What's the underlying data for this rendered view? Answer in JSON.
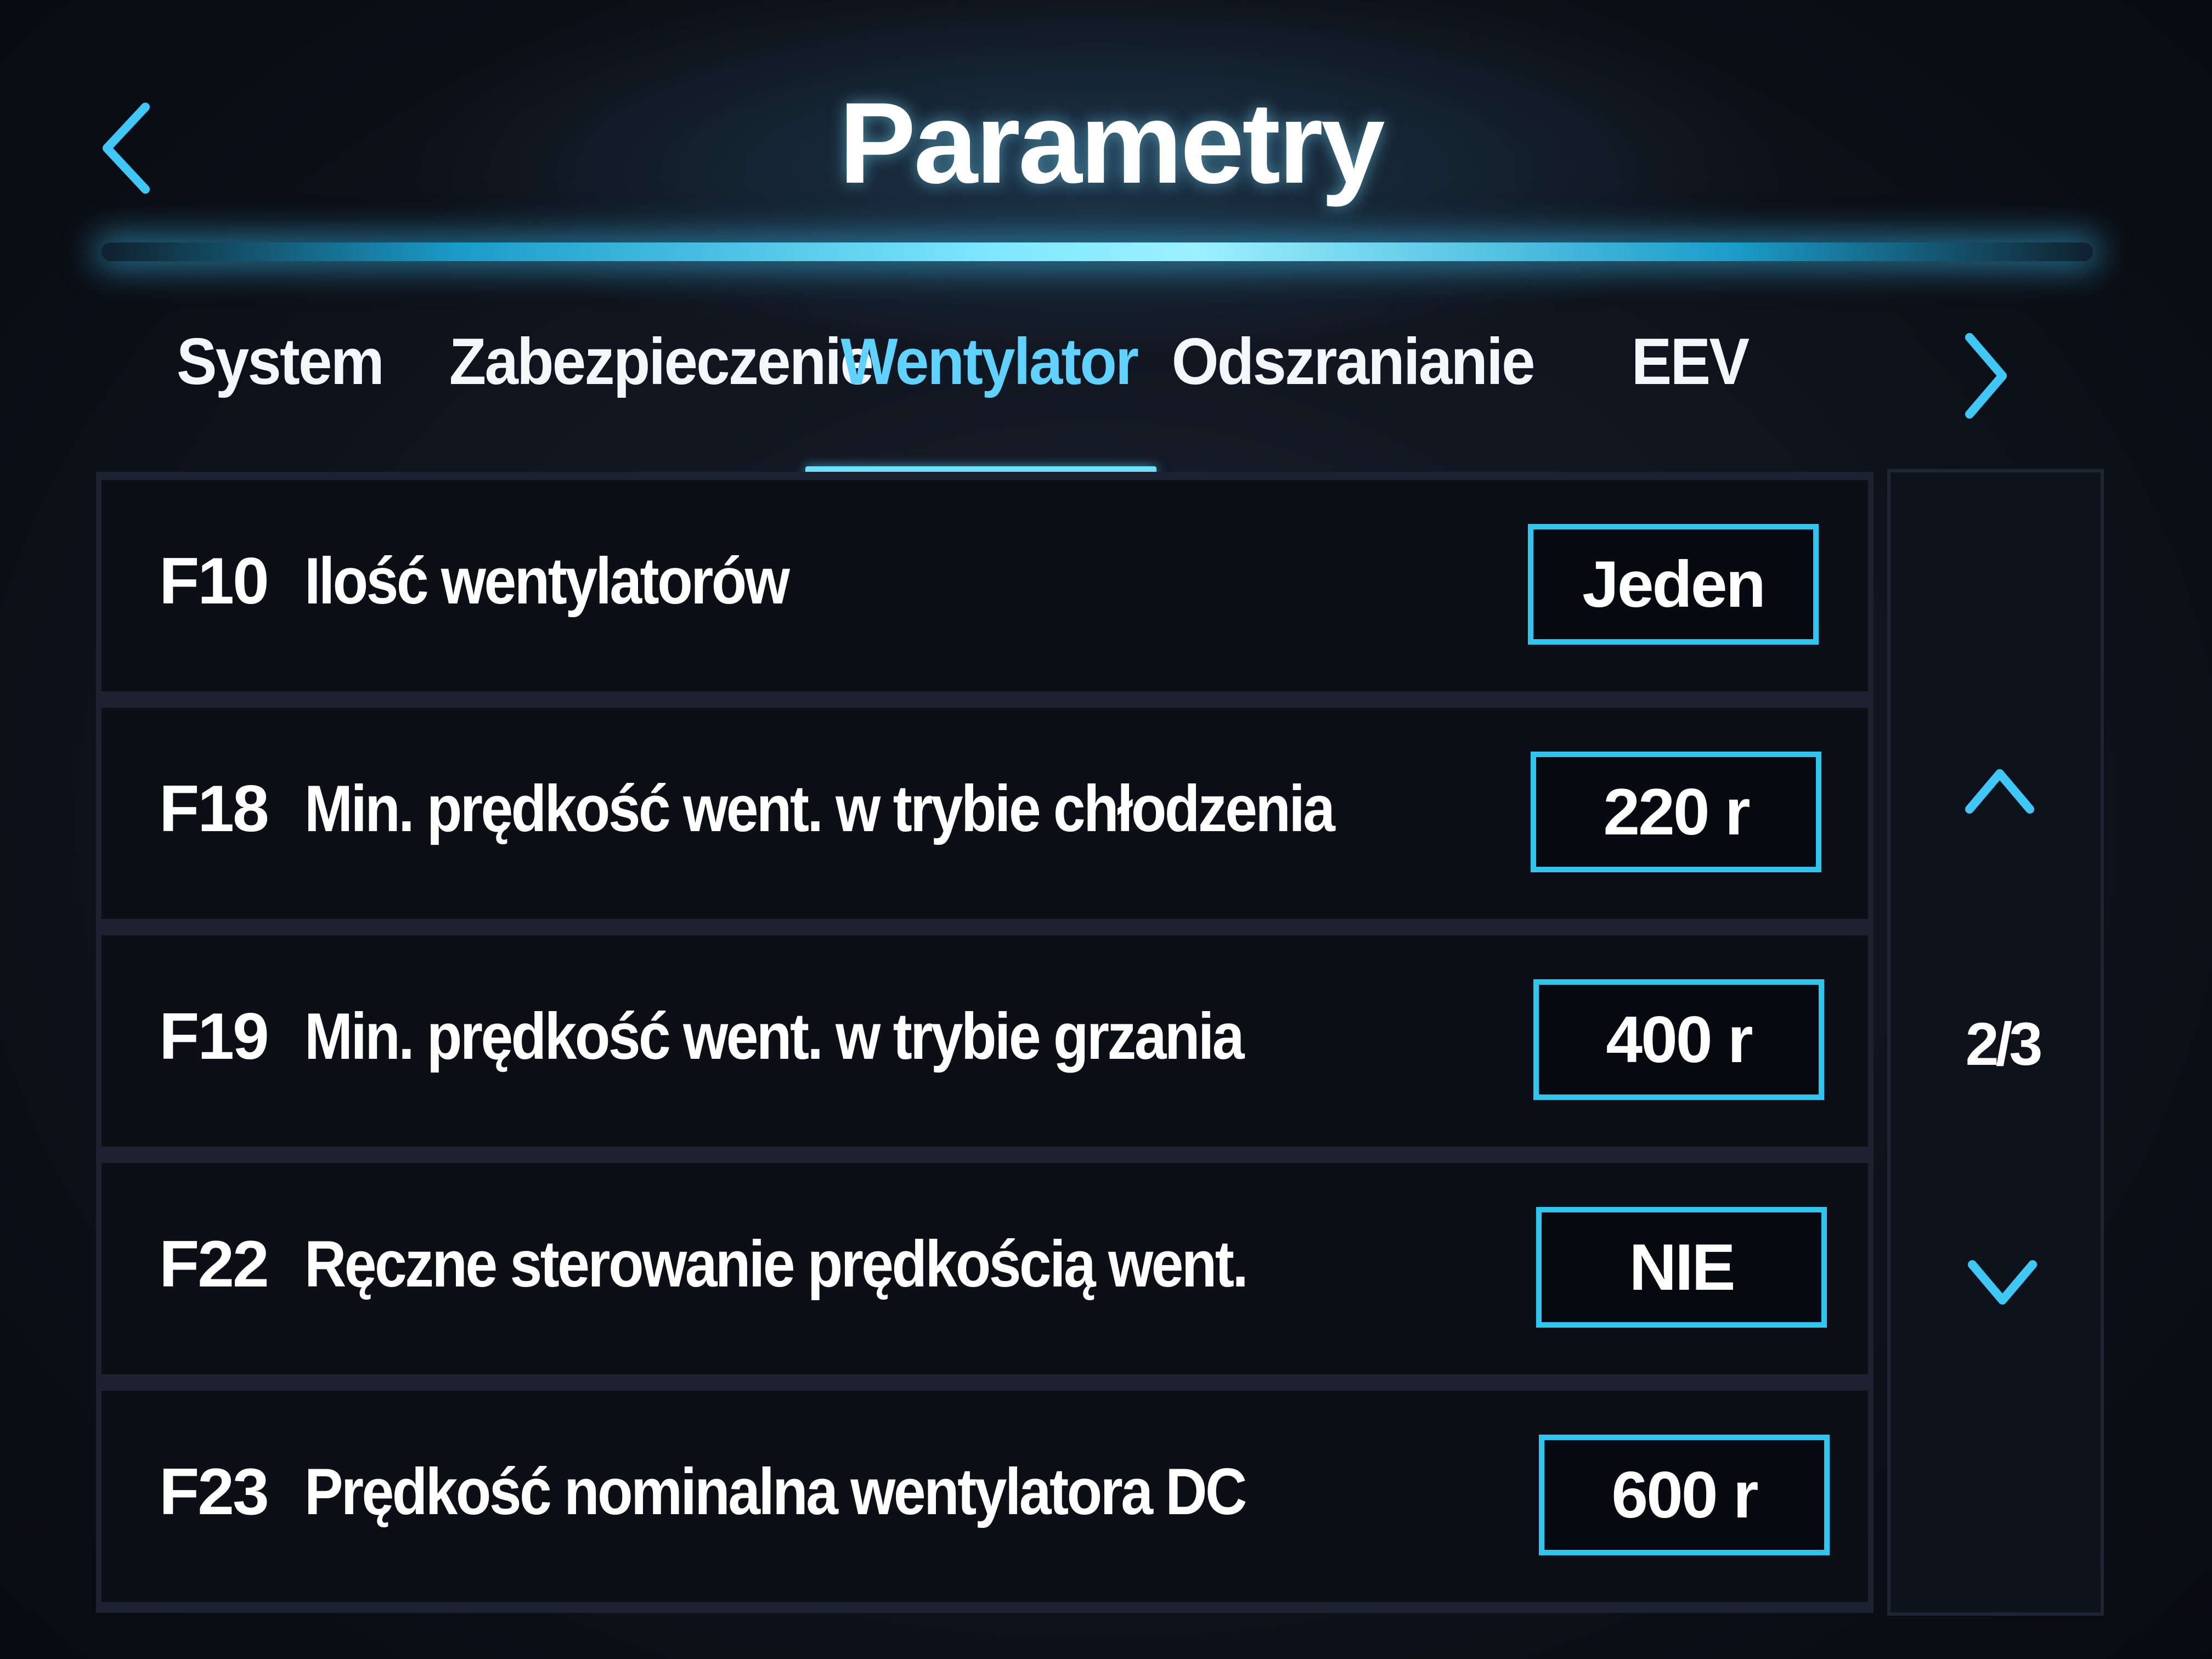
{
  "header": {
    "title": "Parametry",
    "back_icon": "chevron-left-icon"
  },
  "tabs": [
    {
      "label": "System",
      "active": false
    },
    {
      "label": "Zabezpieczenie",
      "active": false
    },
    {
      "label": "Wentylator",
      "active": true
    },
    {
      "label": "Odszranianie",
      "active": false
    },
    {
      "label": "EEV",
      "active": false
    }
  ],
  "tabs_next_icon": "chevron-right-icon",
  "parameters": [
    {
      "code": "F10",
      "label": "Ilość wentylatorów",
      "value": "Jeden"
    },
    {
      "code": "F18",
      "label": "Min. prędkość went. w trybie chłodzenia",
      "value": "220 r"
    },
    {
      "code": "F19",
      "label": "Min. prędkość went. w trybie grzania",
      "value": "400 r"
    },
    {
      "code": "F22",
      "label": "Ręczne sterowanie prędkością went.",
      "value": "NIE"
    },
    {
      "code": "F23",
      "label": "Prędkość nominalna wentylatora DC",
      "value": "600 r"
    }
  ],
  "pager": {
    "page_indicator": "2/3",
    "up_icon": "chevron-up-icon",
    "down_icon": "chevron-down-icon"
  },
  "colors": {
    "accent": "#2ec5ef",
    "active_tab": "#5fd2ff",
    "background": "#0c0f16"
  }
}
